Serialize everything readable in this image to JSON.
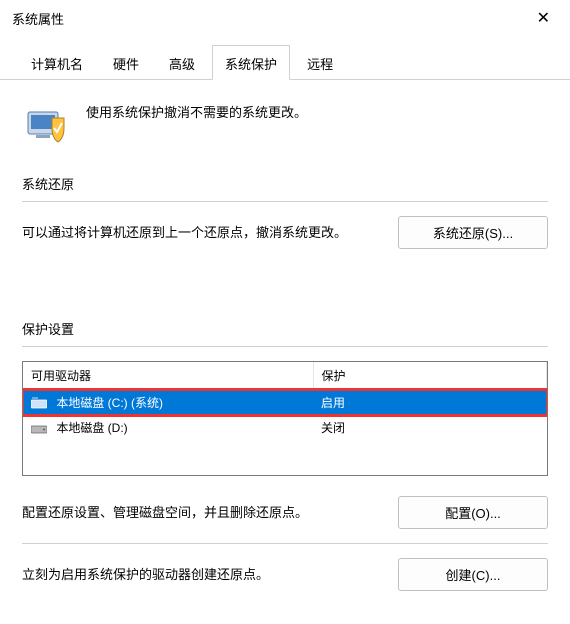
{
  "window": {
    "title": "系统属性"
  },
  "tabs": {
    "t0": "计算机名",
    "t1": "硬件",
    "t2": "高级",
    "t3": "系统保护",
    "t4": "远程"
  },
  "intro": "使用系统保护撤消不需要的系统更改。",
  "restore": {
    "title": "系统还原",
    "desc": "可以通过将计算机还原到上一个还原点，撤消系统更改。",
    "button": "系统还原(S)..."
  },
  "protection": {
    "title": "保护设置",
    "col_drive": "可用驱动器",
    "col_status": "保护",
    "rows": [
      {
        "name": "本地磁盘 (C:) (系统)",
        "status": "启用",
        "selected": true
      },
      {
        "name": "本地磁盘 (D:)",
        "status": "关闭",
        "selected": false
      }
    ],
    "config_desc": "配置还原设置、管理磁盘空间，并且删除还原点。",
    "config_button": "配置(O)...",
    "create_desc": "立刻为启用系统保护的驱动器创建还原点。",
    "create_button": "创建(C)..."
  }
}
